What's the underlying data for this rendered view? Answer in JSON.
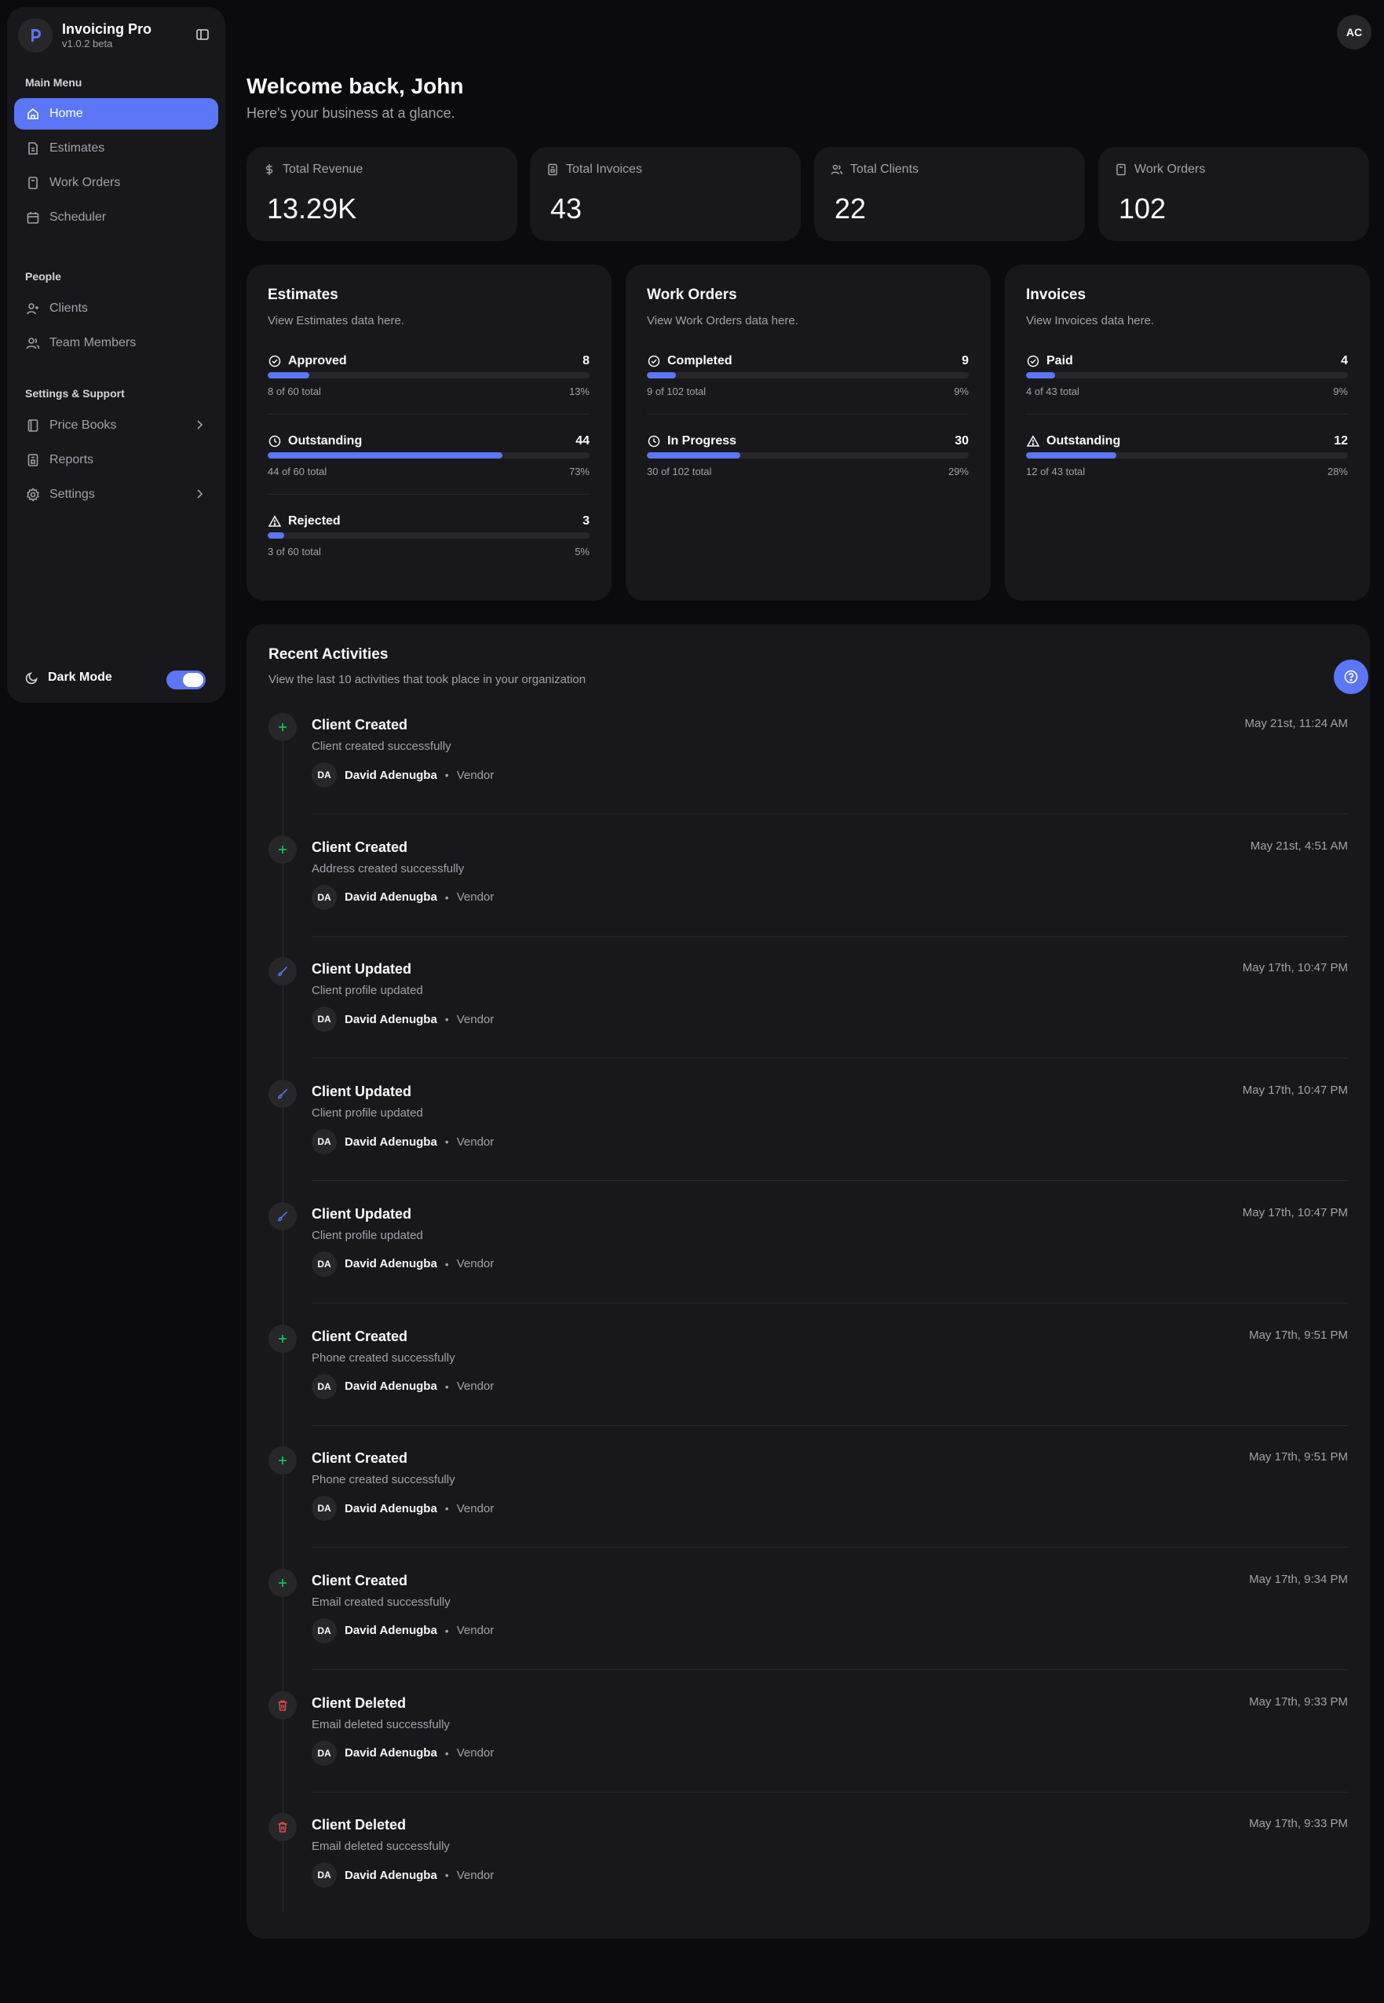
{
  "app": {
    "name": "Invoicing Pro",
    "version": "v1.0.2 beta"
  },
  "sidebar": {
    "sections": [
      "Main Menu",
      "People",
      "Settings & Support"
    ],
    "main_items": [
      {
        "label": "Home",
        "icon": "home-icon",
        "active": true
      },
      {
        "label": "Estimates",
        "icon": "file-icon"
      },
      {
        "label": "Work Orders",
        "icon": "clipboard-icon"
      },
      {
        "label": "Scheduler",
        "icon": "calendar-icon"
      }
    ],
    "people_items": [
      {
        "label": "Clients",
        "icon": "user-plus-icon"
      },
      {
        "label": "Team Members",
        "icon": "users-icon"
      }
    ],
    "support_items": [
      {
        "label": "Price Books",
        "icon": "book-icon"
      },
      {
        "label": "Reports",
        "icon": "report-icon"
      },
      {
        "label": "Settings",
        "icon": "gear-icon"
      }
    ],
    "dark_mode_label": "Dark Mode",
    "dark_mode_on": true
  },
  "header": {
    "avatar_initials": "AC"
  },
  "welcome": {
    "title": "Welcome back, John",
    "subtitle": "Here's your business at a glance."
  },
  "stats": [
    {
      "label": "Total Revenue",
      "value": "13.29K",
      "icon": "dollar-icon"
    },
    {
      "label": "Total Invoices",
      "value": "43",
      "icon": "invoice-icon"
    },
    {
      "label": "Total Clients",
      "value": "22",
      "icon": "users-icon"
    },
    {
      "label": "Work Orders",
      "value": "102",
      "icon": "clipboard-icon"
    }
  ],
  "summaries": [
    {
      "title": "Estimates",
      "description": "View Estimates data here.",
      "metrics": [
        {
          "name": "Approved",
          "count": "8",
          "total": "8 of 60 total",
          "percent": "13%",
          "fraction": 0.13,
          "icon": "check-circle-icon"
        },
        {
          "name": "Outstanding",
          "count": "44",
          "total": "44 of 60 total",
          "percent": "73%",
          "fraction": 0.73,
          "icon": "clock-icon"
        },
        {
          "name": "Rejected",
          "count": "3",
          "total": "3 of 60 total",
          "percent": "5%",
          "fraction": 0.05,
          "icon": "warning-icon"
        }
      ]
    },
    {
      "title": "Work Orders",
      "description": "View Work Orders data here.",
      "metrics": [
        {
          "name": "Completed",
          "count": "9",
          "total": "9 of 102 total",
          "percent": "9%",
          "fraction": 0.09,
          "icon": "check-circle-icon"
        },
        {
          "name": "In Progress",
          "count": "30",
          "total": "30 of 102 total",
          "percent": "29%",
          "fraction": 0.29,
          "icon": "clock-icon"
        }
      ]
    },
    {
      "title": "Invoices",
      "description": "View Invoices data here.",
      "metrics": [
        {
          "name": "Paid",
          "count": "4",
          "total": "4 of 43 total",
          "percent": "9%",
          "fraction": 0.09,
          "icon": "check-circle-icon"
        },
        {
          "name": "Outstanding",
          "count": "12",
          "total": "12 of 43 total",
          "percent": "28%",
          "fraction": 0.28,
          "icon": "warning-icon"
        }
      ]
    }
  ],
  "activities": {
    "title": "Recent Activities",
    "description": "View the last 10 activities that took place in your organization",
    "items": [
      {
        "type": "created",
        "title": "Client Created",
        "message": "Client created successfully",
        "time": "May 21st, 11:24 AM",
        "user_initials": "DA",
        "user_name": "David Adenugba",
        "user_role": "Vendor"
      },
      {
        "type": "created",
        "title": "Client Created",
        "message": "Address created successfully",
        "time": "May 21st, 4:51 AM",
        "user_initials": "DA",
        "user_name": "David Adenugba",
        "user_role": "Vendor"
      },
      {
        "type": "updated",
        "title": "Client Updated",
        "message": "Client profile updated",
        "time": "May 17th, 10:47 PM",
        "user_initials": "DA",
        "user_name": "David Adenugba",
        "user_role": "Vendor"
      },
      {
        "type": "updated",
        "title": "Client Updated",
        "message": "Client profile updated",
        "time": "May 17th, 10:47 PM",
        "user_initials": "DA",
        "user_name": "David Adenugba",
        "user_role": "Vendor"
      },
      {
        "type": "updated",
        "title": "Client Updated",
        "message": "Client profile updated",
        "time": "May 17th, 10:47 PM",
        "user_initials": "DA",
        "user_name": "David Adenugba",
        "user_role": "Vendor"
      },
      {
        "type": "created",
        "title": "Client Created",
        "message": "Phone created successfully",
        "time": "May 17th, 9:51 PM",
        "user_initials": "DA",
        "user_name": "David Adenugba",
        "user_role": "Vendor"
      },
      {
        "type": "created",
        "title": "Client Created",
        "message": "Phone created successfully",
        "time": "May 17th, 9:51 PM",
        "user_initials": "DA",
        "user_name": "David Adenugba",
        "user_role": "Vendor"
      },
      {
        "type": "created",
        "title": "Client Created",
        "message": "Email created successfully",
        "time": "May 17th, 9:34 PM",
        "user_initials": "DA",
        "user_name": "David Adenugba",
        "user_role": "Vendor"
      },
      {
        "type": "deleted",
        "title": "Client Deleted",
        "message": "Email deleted successfully",
        "time": "May 17th, 9:33 PM",
        "user_initials": "DA",
        "user_name": "David Adenugba",
        "user_role": "Vendor"
      },
      {
        "type": "deleted",
        "title": "Client Deleted",
        "message": "Email deleted successfully",
        "time": "May 17th, 9:33 PM",
        "user_initials": "DA",
        "user_name": "David Adenugba",
        "user_role": "Vendor"
      }
    ]
  },
  "colors": {
    "accent": "#5b76f7",
    "created": "#22c55e",
    "updated": "#5b76f7",
    "deleted": "#ef4444"
  }
}
